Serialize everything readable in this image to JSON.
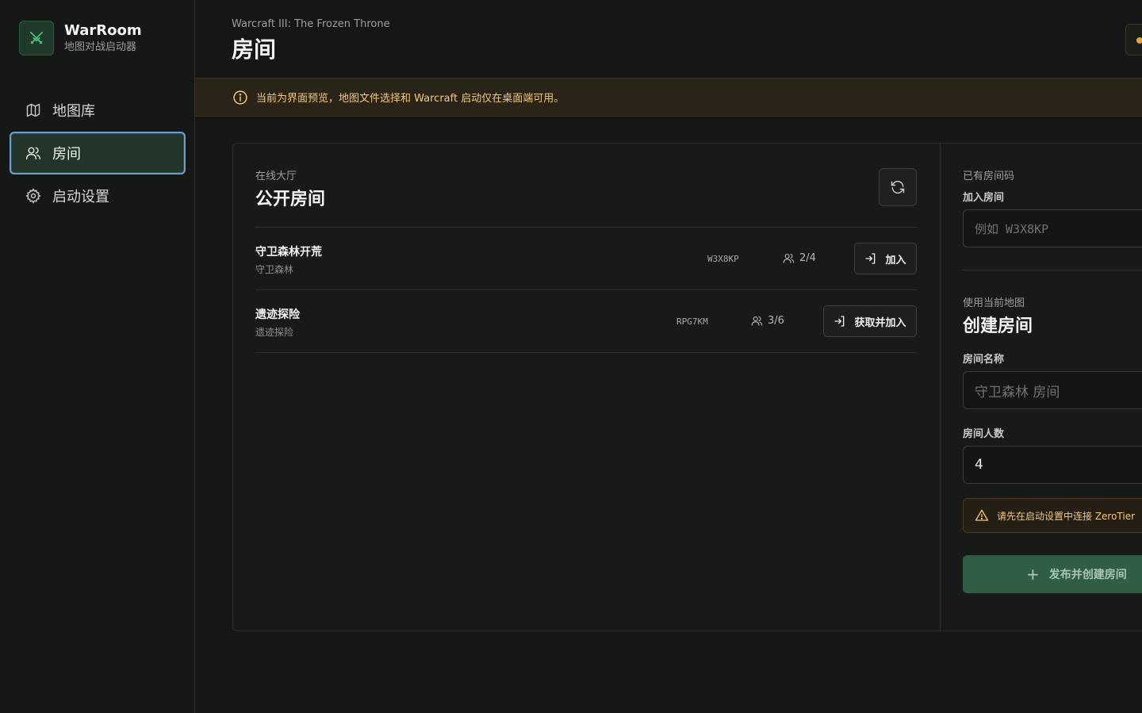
{
  "brand": {
    "title": "WarRoom",
    "subtitle": "地图对战启动器"
  },
  "sidebar": {
    "items": [
      {
        "label": "地图库",
        "icon": "map-icon"
      },
      {
        "label": "房间",
        "icon": "users-icon",
        "active": true
      },
      {
        "label": "启动设置",
        "icon": "gear-icon"
      }
    ]
  },
  "header": {
    "game": "Warcraft III: The Frozen Throne",
    "title": "房间"
  },
  "notice": {
    "text": "当前为界面预览，地图文件选择和 Warcraft 启动仅在桌面端可用。"
  },
  "lobby": {
    "eyebrow": "在线大厅",
    "title": "公开房间",
    "rooms": [
      {
        "name": "守卫森林开荒",
        "map": "守卫森林",
        "code": "W3X8KP",
        "players": "2/4",
        "action": "加入"
      },
      {
        "name": "遗迹探险",
        "map": "遗迹探险",
        "code": "RPG7KM",
        "players": "3/6",
        "action": "获取并加入"
      }
    ]
  },
  "join": {
    "eyebrow": "已有房间码",
    "label": "加入房间",
    "placeholder": "例如 W3X8KP"
  },
  "create": {
    "eyebrow": "使用当前地图",
    "title": "创建房间",
    "name_label": "房间名称",
    "name_placeholder": "守卫森林 房间",
    "size_label": "房间人数",
    "size_value": "4",
    "warning": "请先在启动设置中连接 ZeroTier",
    "button": "发布并创建房间"
  },
  "colors": {
    "accent": "#2f5e44",
    "warning": "#f0c87a",
    "active_border": "#6e9fc9"
  }
}
